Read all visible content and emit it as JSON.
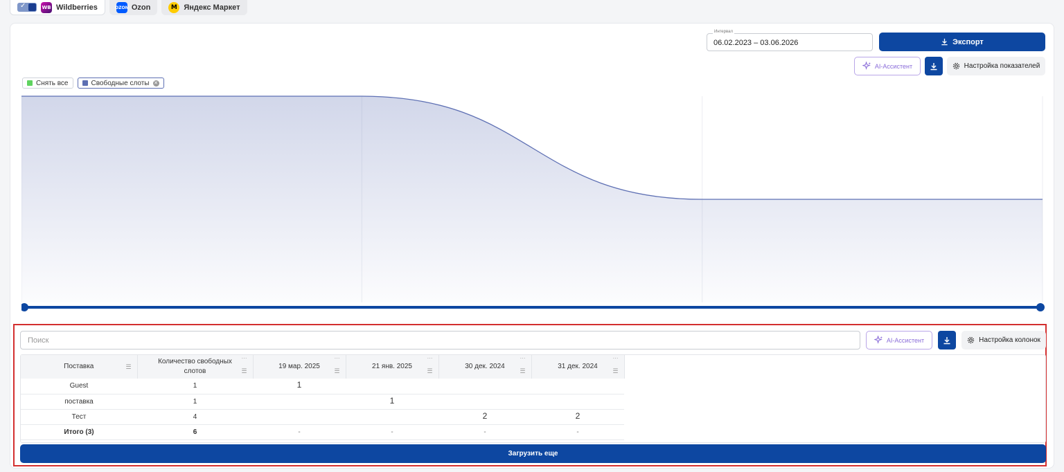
{
  "marketplaces": [
    {
      "name": "Wildberries",
      "logo_text": "WB"
    },
    {
      "name": "Ozon",
      "logo_text": "OZON"
    },
    {
      "name": "Яндекс Маркет",
      "logo_text": "M"
    }
  ],
  "toolbar": {
    "interval_label": "Интервал",
    "interval_value": "06.02.2023 – 03.06.2026",
    "export_label": "Экспорт",
    "ai_label": "AI-Ассистент",
    "settings_label": "Настройка показателей"
  },
  "legend": {
    "clear_all": "Снять все",
    "series_name": "Свободные слоты",
    "clear_color": "#4caf50",
    "series_color": "#5d6fb3"
  },
  "chart_data": {
    "type": "area",
    "series": [
      {
        "name": "Свободные слоты",
        "values": [
          2,
          2,
          1,
          1
        ]
      }
    ],
    "ylim": [
      0,
      2
    ],
    "grid": true,
    "color": "#5d6fb3"
  },
  "table": {
    "search_placeholder": "Поиск",
    "ai_label": "AI-Ассистент",
    "settings_label": "Настройка колонок",
    "columns": [
      "Поставка",
      "Количество свободных слотов",
      "19 мар. 2025",
      "21 янв. 2025",
      "30 дек. 2024",
      "31 дек. 2024"
    ],
    "rows": [
      [
        "Guest",
        "1",
        "1",
        "",
        "",
        ""
      ],
      [
        "поставка",
        "1",
        "",
        "1",
        "",
        ""
      ],
      [
        "Тест",
        "4",
        "",
        "",
        "2",
        "2"
      ]
    ],
    "total": [
      "Итого (3)",
      "6",
      "-",
      "-",
      "-",
      "-"
    ],
    "load_more": "Загрузить еще"
  }
}
